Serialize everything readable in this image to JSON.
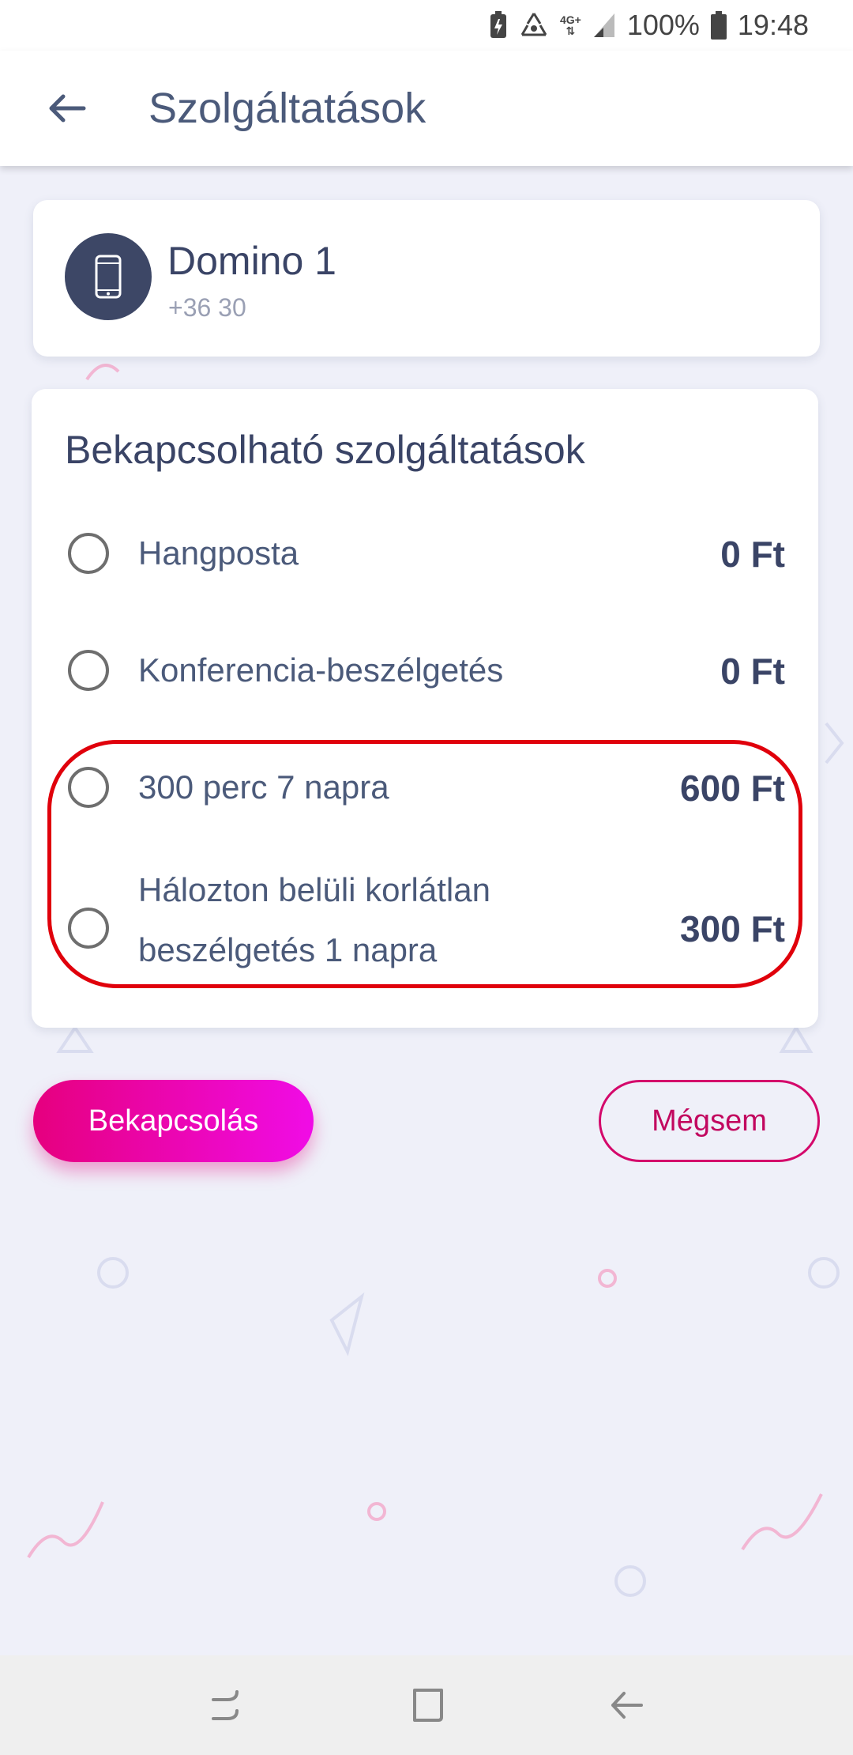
{
  "status_bar": {
    "battery_percent": "100%",
    "time": "19:48",
    "network": "4G+",
    "icons": [
      "battery-saver-icon",
      "recycle-icon",
      "network-4g-icon",
      "signal-icon",
      "battery-icon"
    ]
  },
  "app_bar": {
    "title": "Szolgáltatások",
    "back_icon": "arrow-left-icon"
  },
  "device": {
    "name": "Domino 1",
    "phone": "+36 30",
    "icon": "smartphone-icon"
  },
  "services": {
    "title": "Bekapcsolható szolgáltatások",
    "items": [
      {
        "label": "Hangposta",
        "price": "0 Ft",
        "selected": false
      },
      {
        "label": "Konferencia-beszélgetés",
        "price": "0 Ft",
        "selected": false
      },
      {
        "label": "300 perc 7 napra",
        "price": "600 Ft",
        "selected": false
      },
      {
        "label_line1": "Hálozton belüli korlátlan",
        "label_line2": "beszélgetés 1 napra",
        "price": "300 Ft",
        "selected": false
      }
    ]
  },
  "actions": {
    "activate_label": "Bekapcsolás",
    "cancel_label": "Mégsem"
  },
  "colors": {
    "accent": "#e6007e",
    "accent_end": "#f00ce6",
    "highlight": "#e0000b",
    "text_primary": "#3a4466",
    "background": "#eff0f9"
  },
  "nav_bar": {
    "icons": [
      "recent-apps-icon",
      "home-icon",
      "back-icon"
    ]
  }
}
